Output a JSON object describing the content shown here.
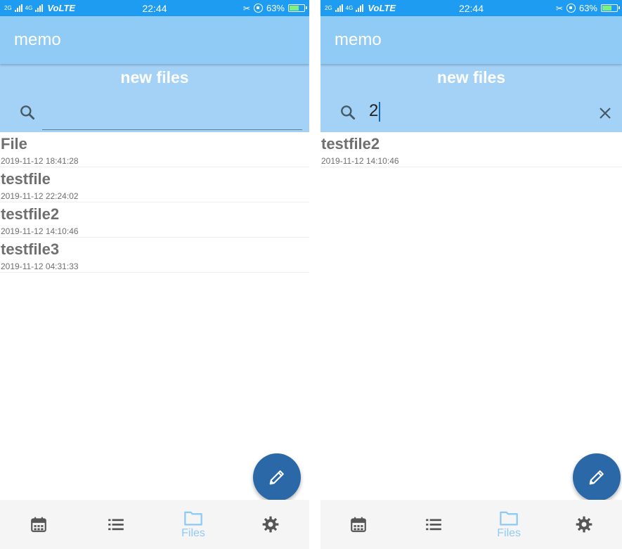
{
  "statusbar": {
    "network_top": "2G",
    "network_4g": "4G",
    "volte": "VoLTE",
    "time": "22:44",
    "battery": "63%",
    "battery_level": 0.63
  },
  "app": {
    "title": "memo",
    "section_title": "new files"
  },
  "left": {
    "search_value": "",
    "files": [
      {
        "name": "File",
        "date": "2019-11-12 18:41:28"
      },
      {
        "name": "testfile",
        "date": "2019-11-12 22:24:02"
      },
      {
        "name": "testfile2",
        "date": "2019-11-12 14:10:46"
      },
      {
        "name": "testfile3",
        "date": "2019-11-12 04:31:33"
      }
    ]
  },
  "right": {
    "search_value": "2",
    "files": [
      {
        "name": "testfile2",
        "date": "2019-11-12 14:10:46"
      }
    ]
  },
  "nav": {
    "items": [
      {
        "icon": "calendar-icon",
        "label": ""
      },
      {
        "icon": "list-icon",
        "label": ""
      },
      {
        "icon": "folder-icon",
        "label": "Files",
        "active": true
      },
      {
        "icon": "gear-icon",
        "label": ""
      }
    ]
  },
  "colors": {
    "statusbar": "#1e9cf2",
    "appbar": "#90cbf6",
    "header": "#a4d2f7",
    "fab": "#2a68a8",
    "active_nav": "#90cbf6",
    "inactive_nav": "#555555"
  },
  "fab_icon": "pencil-icon"
}
